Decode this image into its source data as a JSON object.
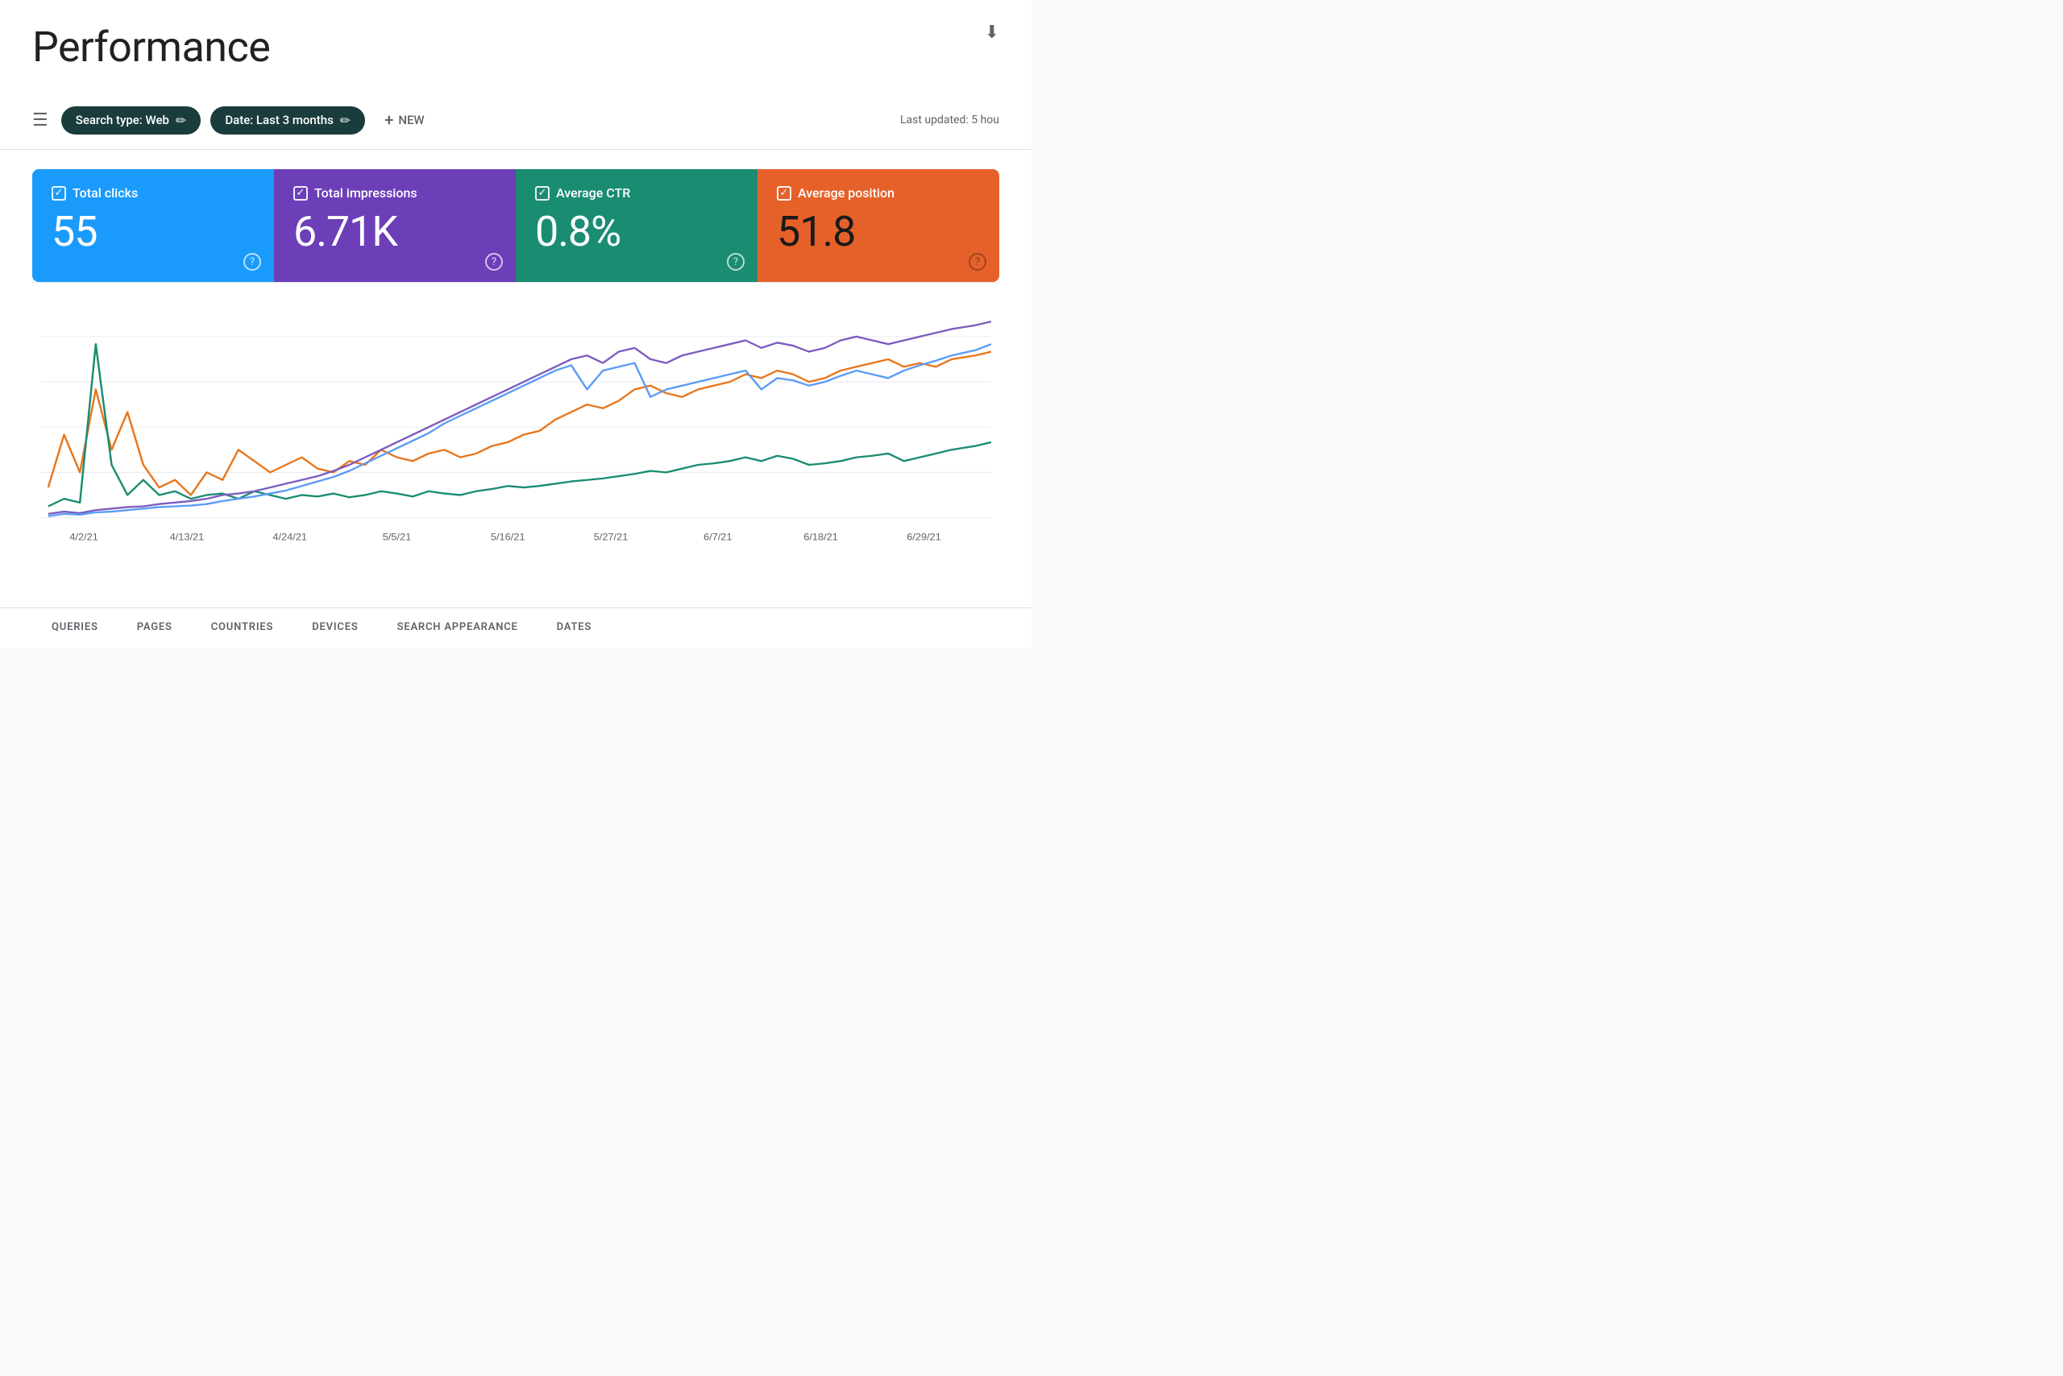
{
  "header": {
    "title": "Performance",
    "download_icon": "⬇"
  },
  "toolbar": {
    "filter_icon": "☰",
    "search_type_chip": "Search type: Web",
    "date_chip": "Date: Last 3 months",
    "new_button": "+ NEW",
    "last_updated": "Last updated: 5 hou"
  },
  "metrics": [
    {
      "id": "clicks",
      "label": "Total clicks",
      "value": "55",
      "color_class": "clicks"
    },
    {
      "id": "impressions",
      "label": "Total impressions",
      "value": "6.71K",
      "color_class": "impressions"
    },
    {
      "id": "ctr",
      "label": "Average CTR",
      "value": "0.8%",
      "color_class": "ctr"
    },
    {
      "id": "position",
      "label": "Average position",
      "value": "51.8",
      "color_class": "position"
    }
  ],
  "chart": {
    "x_labels": [
      "4/2/21",
      "4/13/21",
      "4/24/21",
      "5/5/21",
      "5/16/21",
      "5/27/21",
      "6/7/21",
      "6/18/21",
      "6/29/21"
    ],
    "lines": {
      "blue_light": "#5b9cf6",
      "orange": "#e8761c",
      "teal": "#1a8c72",
      "purple": "#7c5cbf"
    }
  },
  "tabs": [
    {
      "label": "QUERIES",
      "active": false
    },
    {
      "label": "PAGES",
      "active": false
    },
    {
      "label": "COUNTRIES",
      "active": false
    },
    {
      "label": "DEVICES",
      "active": false
    },
    {
      "label": "SEARCH APPEARANCE",
      "active": false
    },
    {
      "label": "DATES",
      "active": false
    }
  ]
}
